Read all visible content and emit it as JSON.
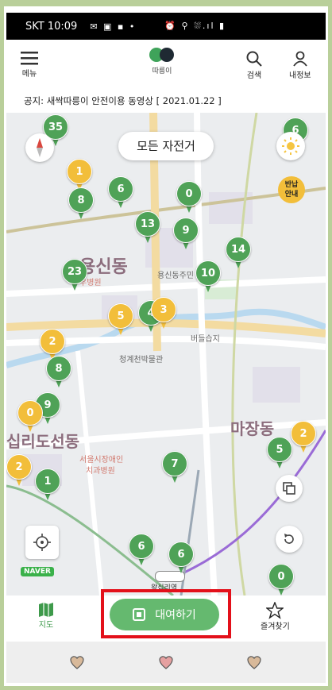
{
  "status_bar": {
    "carrier_time": "SKT 10:09",
    "notif_icons": "✉ ▣ ▪ •",
    "right_icons": "⏰ ⚲ ⛆.ıl ▮"
  },
  "header": {
    "menu_label": "메뉴",
    "logo_text": "따릉이",
    "search_label": "검색",
    "profile_label": "내정보"
  },
  "notice": {
    "text": "공지: 새싹따릉이 안전이용 동영상 [ 2021.01.22 ]"
  },
  "map": {
    "filter_label": "모든 자전거",
    "return_badge_line1": "반납",
    "return_badge_line2": "안내",
    "area_labels": [
      "용신동",
      "마장동",
      "십리도선동"
    ],
    "poi_labels": [
      "우병원",
      "용신동주민",
      "버들습지",
      "청계천박물관",
      "서울시장애인",
      "치과병원",
      "왕십리역"
    ],
    "provider_badge": "NAVER",
    "pins": [
      {
        "color": "green",
        "count": "35"
      },
      {
        "color": "yellow",
        "count": "1"
      },
      {
        "color": "green",
        "count": "8"
      },
      {
        "color": "green",
        "count": "6"
      },
      {
        "color": "green",
        "count": "0"
      },
      {
        "color": "green",
        "count": "13"
      },
      {
        "color": "green",
        "count": "9"
      },
      {
        "color": "green",
        "count": "14"
      },
      {
        "color": "green",
        "count": "23"
      },
      {
        "color": "green",
        "count": "10"
      },
      {
        "color": "yellow",
        "count": "5"
      },
      {
        "color": "green",
        "count": "4"
      },
      {
        "color": "yellow",
        "count": "3"
      },
      {
        "color": "yellow",
        "count": "2"
      },
      {
        "color": "green",
        "count": "8"
      },
      {
        "color": "green",
        "count": "9"
      },
      {
        "color": "yellow",
        "count": "0"
      },
      {
        "color": "yellow",
        "count": "2"
      },
      {
        "color": "green",
        "count": "1"
      },
      {
        "color": "green",
        "count": "7"
      },
      {
        "color": "green",
        "count": "5"
      },
      {
        "color": "yellow",
        "count": "2"
      },
      {
        "color": "green",
        "count": "6"
      },
      {
        "color": "green",
        "count": "6"
      },
      {
        "color": "green",
        "count": "0"
      },
      {
        "color": "green",
        "count": "6"
      }
    ]
  },
  "bottom_tabs": {
    "map_label": "지도",
    "rent_label": "대여하기",
    "favorites_label": "즐겨찾기"
  },
  "colors": {
    "brand_green": "#4fa257",
    "yellow_pin": "#f2be3a",
    "highlight_red": "#e3101a"
  }
}
